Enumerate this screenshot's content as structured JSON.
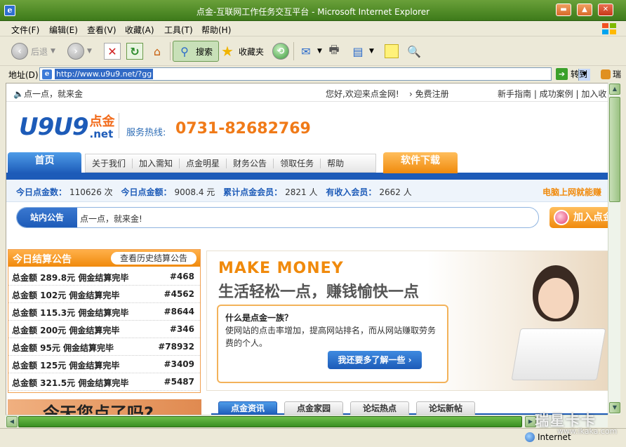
{
  "window": {
    "title": "点金-互联网工作任务交互平台 - Microsoft Internet Explorer"
  },
  "menu": [
    "文件(F)",
    "编辑(E)",
    "查看(V)",
    "收藏(A)",
    "工具(T)",
    "帮助(H)"
  ],
  "toolbar": {
    "back": "后退",
    "search": "搜索",
    "favorites": "收藏夹"
  },
  "address": {
    "label": "地址(D)",
    "url": "http://www.u9u9.net/?gg",
    "go": "转到",
    "extra": "瑞"
  },
  "status": {
    "zone": "Internet",
    "watermark": "瑞星卡卡",
    "watermark_sub": "www.ikaka.com"
  },
  "page": {
    "slogan": "🔈点一点，就来金",
    "welcome": "您好,欢迎来点金网!",
    "register": "› 免费注册",
    "top_links": "新手指南 | 成功案例 | 加入收",
    "logo_main": "U9U9",
    "logo_cn": "点金",
    "logo_net": ".net",
    "hotline_label": "服务热线:",
    "hotline": "0731-82682769",
    "nav_home": "首页",
    "nav_tabs": [
      "关于我们",
      "加入需知",
      "点金明星",
      "财务公告",
      "领取任务",
      "帮助"
    ],
    "nav_download": "软件下载",
    "stats": {
      "clicks_label": "今日点金数：",
      "clicks_value": "110626 次",
      "amount_label": "今日点金额：",
      "amount_value": "9008.4 元",
      "members_label": "累计点金会员：",
      "members_value": "2821 人",
      "earning_label": "有收入会员：",
      "earning_value": "2662 人",
      "right_promo": "电脑上网就能赚"
    },
    "notice_label": "站内公告",
    "notice_text": "点一点，就来金!",
    "join_btn": "加入点金",
    "settle": {
      "title": "今日结算公告",
      "history": "查看历史结算公告",
      "rows": [
        {
          "text": "总金额  289.8元  佣金结算完毕",
          "id": "#468"
        },
        {
          "text": "总金额  102元  佣金结算完毕",
          "id": "#4562"
        },
        {
          "text": "总金额  115.3元  佣金结算完毕",
          "id": "#8644"
        },
        {
          "text": "总金额  200元  佣金结算完毕",
          "id": "#346"
        },
        {
          "text": "总金额  95元  佣金结算完毕",
          "id": "#78932"
        },
        {
          "text": "总金额  125元  佣金结算完毕",
          "id": "#3409"
        },
        {
          "text": "总金额  321.5元  佣金结算完毕",
          "id": "#5487"
        }
      ]
    },
    "banner": {
      "headline": "MAKE MONEY",
      "slogan": "生活轻松一点，赚钱愉快一点",
      "what_title": "什么是点金一族？",
      "what_desc": "使网站的点击率增加，提高网站排名，而从网站赚取劳务费的个人。",
      "what_btn": "我还要多了解一些 ›"
    },
    "ad_text": "今天您点了吗?",
    "bottom_tabs": [
      "点金资讯",
      "点金家园",
      "论坛热点",
      "论坛新帖"
    ]
  },
  "colors": {
    "brand_blue": "#1d5bb8",
    "brand_orange": "#f08a0c",
    "xp_green": "#4f8a26"
  }
}
